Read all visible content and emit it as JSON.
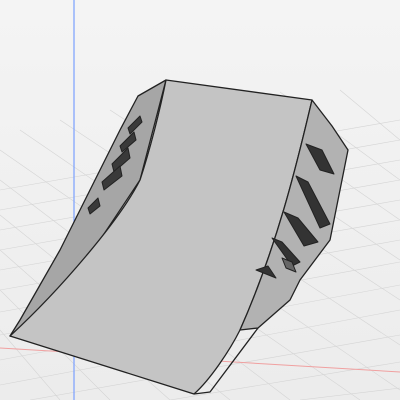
{
  "viewport": {
    "background_color": "#f0f0f0",
    "grid_color": "#d0d0d0",
    "y_axis_color": "#7aa0ff",
    "x_axis_color": "#f0a0a0"
  },
  "model": {
    "shape": "ramp-with-slots",
    "fill_color": "#bdbdbd",
    "face_color": "#a8a8a8",
    "edge_color": "#222222",
    "slot_color": "#333333"
  }
}
